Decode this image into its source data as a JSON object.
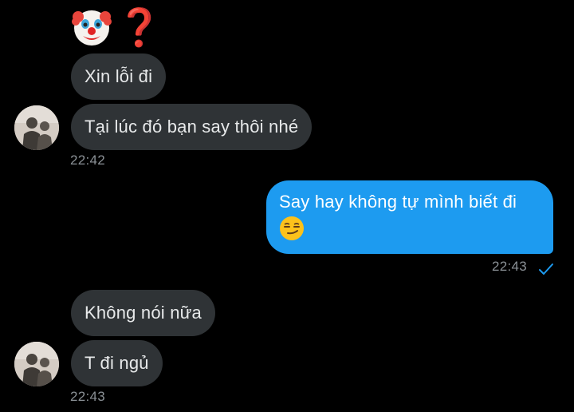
{
  "messages": {
    "reaction": {
      "emoji_1": "clown-face",
      "emoji_2": "❓"
    },
    "incoming_1": {
      "bubble_1": "Xin lỗi đi",
      "bubble_2": "Tại lúc đó bạn say thôi nhé",
      "time": "22:42"
    },
    "outgoing_1": {
      "text": "Say hay không tự mình biết đi",
      "emoji": "smirking-face",
      "time": "22:43",
      "status": "sent"
    },
    "incoming_2": {
      "bubble_1": "Không nói nữa",
      "bubble_2": "T đi ngủ",
      "time": "22:43"
    }
  },
  "colors": {
    "background": "#000000",
    "incoming_bubble": "#2f3336",
    "outgoing_bubble": "#1d9bf0",
    "timestamp": "#8b9196",
    "check": "#1d9bf0"
  }
}
